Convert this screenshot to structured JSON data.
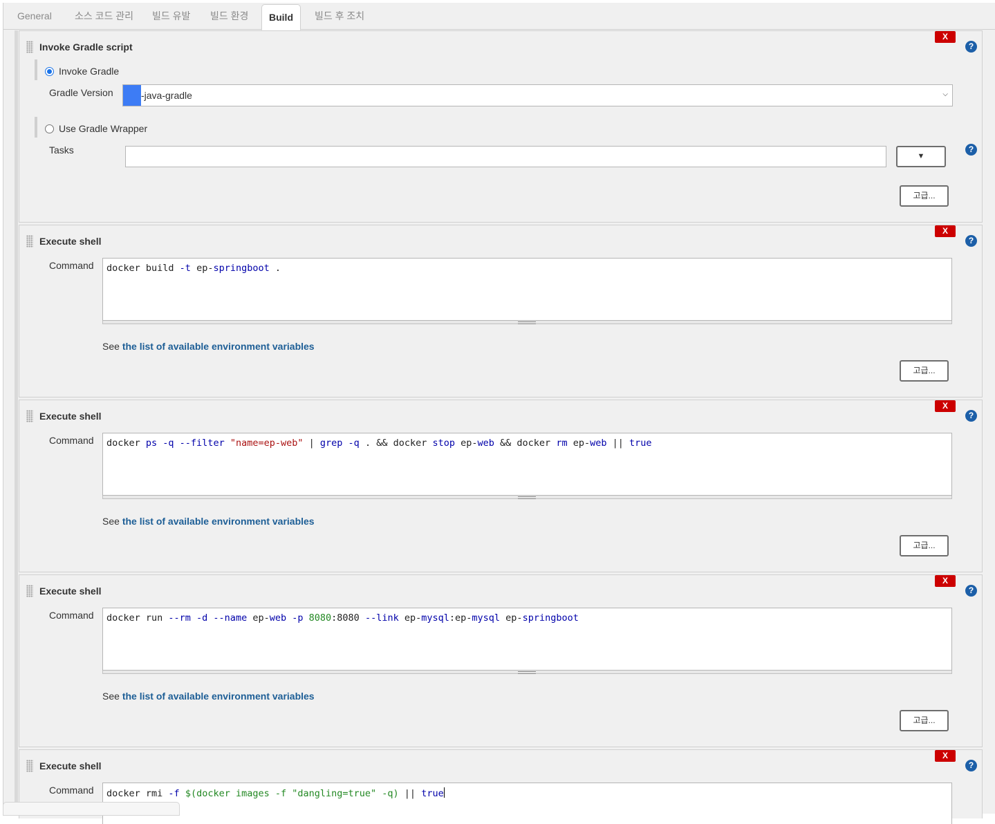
{
  "tabs": [
    {
      "label": "General",
      "active": false
    },
    {
      "label": "소스 코드 관리",
      "active": false
    },
    {
      "label": "빌드 유발",
      "active": false
    },
    {
      "label": "빌드 환경",
      "active": false
    },
    {
      "label": "Build",
      "active": true
    },
    {
      "label": "빌드 후 조치",
      "active": false
    }
  ],
  "delete_label": "X",
  "help_label": "?",
  "advanced_label": "고급...",
  "gradle": {
    "title": "Invoke Gradle script",
    "invoke_label": "Invoke Gradle",
    "invoke_selected": true,
    "version_label": "Gradle Version",
    "version_value": "-java-gradle",
    "wrapper_label": "Use Gradle Wrapper",
    "wrapper_selected": false,
    "tasks_label": "Tasks",
    "tasks_value": "",
    "tasks_dropdown": "▼"
  },
  "shell": {
    "title": "Execute shell",
    "command_label": "Command",
    "see_prefix": "See ",
    "see_link": "the list of available environment variables"
  },
  "commands": [
    "docker build -t ep-springboot .",
    "docker ps -q --filter \"name=ep-web\" | grep -q . && docker stop ep-web && docker rm ep-web || true",
    "docker run --rm -d --name ep-web -p 8080:8080 --link ep-mysql:ep-mysql ep-springboot",
    "docker rmi -f $(docker images -f \"dangling=true\" -q) || true"
  ],
  "colors": {
    "delete_button": "#cc0000",
    "help_icon": "#1c5fa8",
    "link": "#1d5e96",
    "radio_selected": "#1a73e8"
  }
}
